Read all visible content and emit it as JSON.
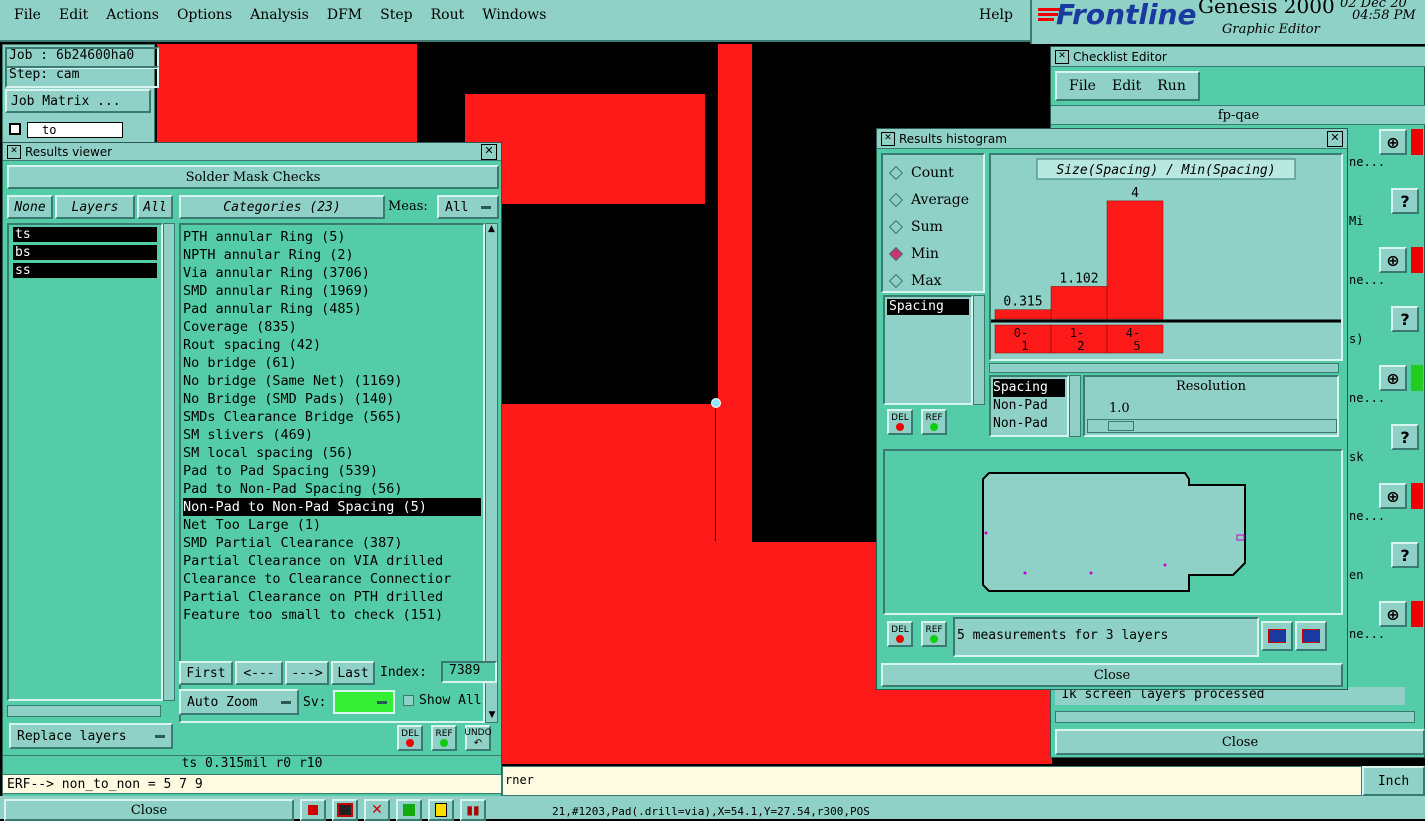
{
  "menubar": {
    "items": [
      "File",
      "Edit",
      "Actions",
      "Options",
      "Analysis",
      "DFM",
      "Step",
      "Rout",
      "Windows"
    ],
    "help": "Help",
    "brand": "Frontline",
    "product": "Genesis 2000",
    "subtitle": "Graphic Editor",
    "date": "02 Dec 20",
    "time": "04:58 PM"
  },
  "job_panel": {
    "job": "Job : 6b24600ha0",
    "step": "Step: cam",
    "job_matrix": "Job Matrix ...",
    "layer_field": "to"
  },
  "results_viewer": {
    "title": "Results viewer",
    "header": "Solder Mask Checks",
    "none_btn": "None",
    "layers_btn": "Layers",
    "all_btn": "All",
    "layers": [
      "ts",
      "bs",
      "ss"
    ],
    "categories_btn": "Categories (23)",
    "meas_label": "Meas:",
    "meas_value": "All",
    "categories": [
      "PTH annular Ring (5)",
      "NPTH annular Ring (2)",
      "Via annular Ring (3706)",
      "SMD annular Ring (1969)",
      "Pad annular Ring (485)",
      "Coverage (835)",
      "Rout spacing (42)",
      "No bridge (61)",
      "No bridge (Same Net) (1169)",
      "No Bridge (SMD Pads) (140)",
      "SMDs Clearance Bridge (565)",
      "SM slivers (469)",
      "SM local spacing (56)",
      "Pad to Pad Spacing (539)",
      "Pad to Non-Pad Spacing (56)",
      "Non-Pad to Non-Pad Spacing (5)",
      "Net Too Large (1)",
      "SMD Partial Clearance (387)",
      "Partial Clearance on VIA drilled",
      "Clearance to Clearance Connectior",
      "Partial Clearance on PTH drilled",
      "Feature too small to check (151)"
    ],
    "selected_index": 15,
    "nav": {
      "first": "First",
      "prev": "<---",
      "next": "--->",
      "last": "Last",
      "index_label": "Index:",
      "index_value": "7389"
    },
    "auto_zoom": "Auto Zoom",
    "sv_label": "Sv:",
    "show_all": "Show All",
    "replace_layers": "Replace layers",
    "del": "DEL",
    "ref": "REF",
    "undo": "UNDO",
    "status": "ts 0.315mil  r0  r10",
    "close": "Close"
  },
  "erf_line": "ERF--> non_to_non = 5 7 9",
  "message_line": "rner",
  "status_bar": "21,#1203,Pad(.drill=via),X=54.1,Y=27.54,r300,POS",
  "units": "Inch",
  "checklist": {
    "title": "Checklist Editor",
    "menu": [
      "File",
      "Edit",
      "Run"
    ],
    "name": "fp-qae",
    "row_labels": [
      "ne...",
      "Mi",
      "ne...",
      "s)",
      "ne...",
      "sk",
      "ne...",
      "en",
      "ne..."
    ],
    "log_text": "1k screen layers processed",
    "close": "Close"
  },
  "histogram": {
    "title": "Results histogram",
    "modes": [
      "Count",
      "Average",
      "Sum",
      "Min",
      "Max"
    ],
    "selected_mode": 3,
    "measure_list": [
      "Spacing"
    ],
    "chart_title": "Size(Spacing) / Min(Spacing)",
    "chart_data": {
      "type": "bar",
      "categories": [
        "0-\n1",
        "1-\n2",
        "4-\n5"
      ],
      "values": [
        0.315,
        1.102,
        4
      ],
      "value_labels": [
        "0.315",
        "1.102",
        "4"
      ],
      "ylim": [
        0,
        4.2
      ]
    },
    "lower_list": [
      "Spacing",
      "Non-Pad",
      "Non-Pad"
    ],
    "resolution_label": "Resolution",
    "resolution_value": "1.0",
    "measurement_summary": "5 measurements for 3 layers",
    "del": "DEL",
    "ref": "REF",
    "close": "Close"
  }
}
